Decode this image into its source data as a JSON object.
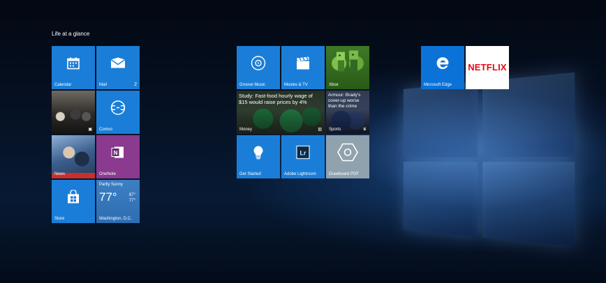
{
  "group": {
    "title": "Life at a glance"
  },
  "tiles": {
    "calendar": {
      "label": "Calendar"
    },
    "mail": {
      "label": "Mail",
      "badge": "2"
    },
    "photos": {
      "label": ""
    },
    "comms": {
      "label": "Comvo"
    },
    "news": {
      "label": "News"
    },
    "onenote": {
      "label": "OneNote"
    },
    "store": {
      "label": "Store"
    },
    "weather": {
      "condition": "Partly Sunny",
      "temp": "77°",
      "high": "87°",
      "low": "77°",
      "label": "Washington, D.C."
    },
    "groove": {
      "label": "Groove Music"
    },
    "movies": {
      "label": "Movies & TV"
    },
    "xbox": {
      "label": "Xbox"
    },
    "money": {
      "headline": "Study: Fast-food hourly wage of $15 would raise prices by 4%",
      "label": "Money"
    },
    "sports": {
      "headline": "Armour: Brady's cover-up worse than the crime",
      "label": "Sports"
    },
    "get_started": {
      "label": "Get Started"
    },
    "lightroom": {
      "label": "Adobe Lightroom"
    },
    "drawboard": {
      "label": "Drawboard PDF"
    },
    "edge": {
      "label": "Microsoft Edge"
    },
    "netflix": {
      "logo": "NETFLIX"
    }
  },
  "colors": {
    "tile_blue": "#1a7ed8",
    "onenote_purple": "#8a3a8f",
    "netflix_red": "#e50914"
  }
}
